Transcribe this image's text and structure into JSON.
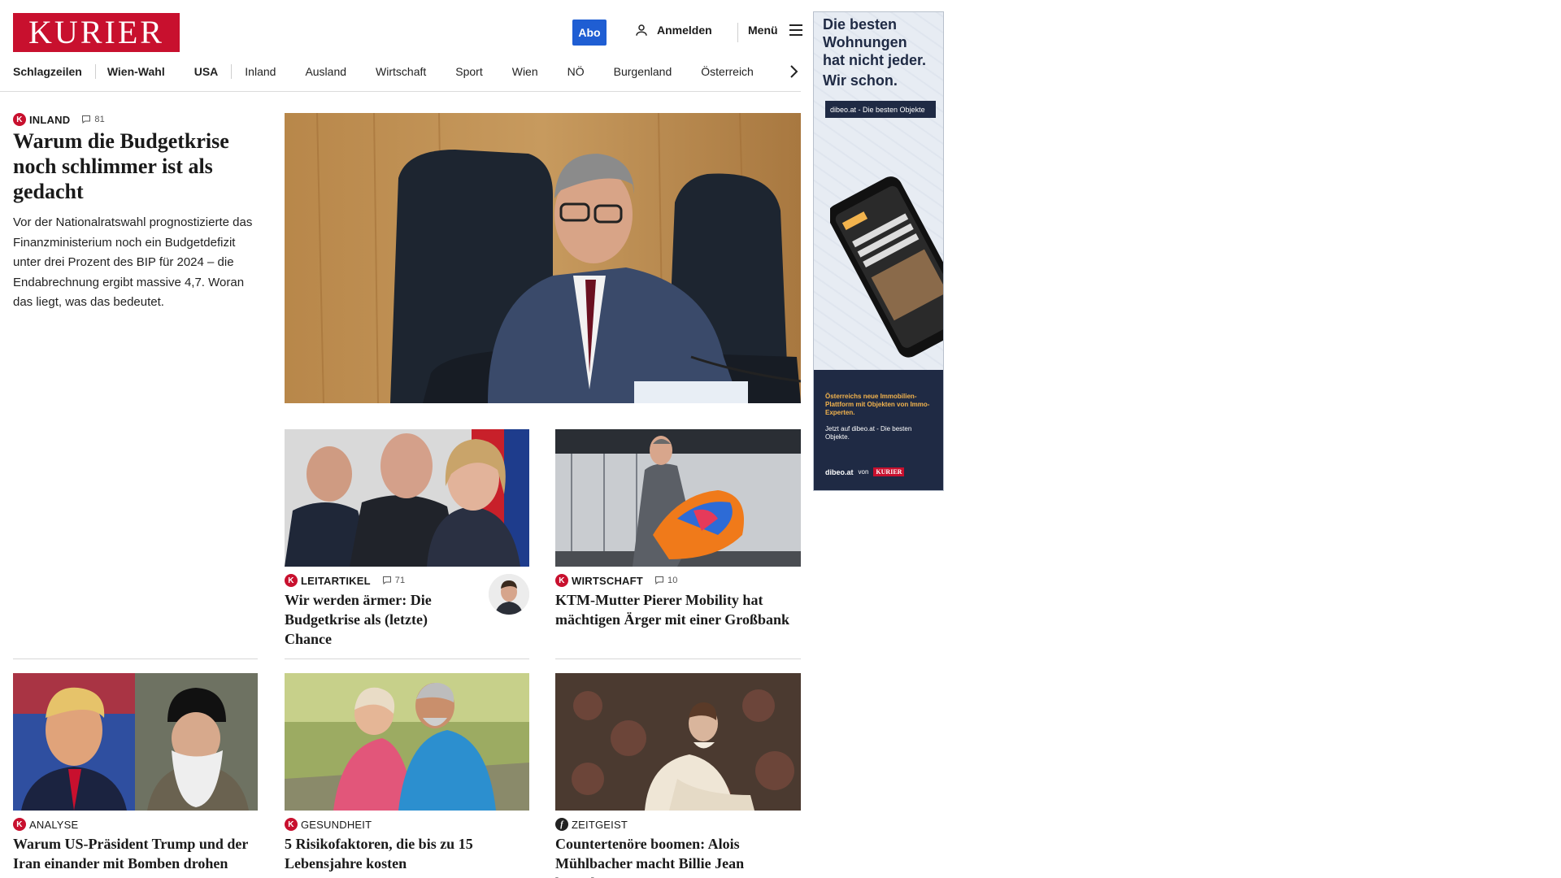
{
  "header": {
    "logo_text": "KURIER",
    "abo_label": "Abo",
    "login_label": "Anmelden",
    "menu_label": "Menü"
  },
  "nav": {
    "items": [
      "Schlagzeilen",
      "Wien-Wahl",
      "USA",
      "Inland",
      "Ausland",
      "Wirtschaft",
      "Sport",
      "Wien",
      "NÖ",
      "Burgenland",
      "Österreich"
    ]
  },
  "lead": {
    "category": "INLAND",
    "comments": "81",
    "headline": "Warum die Budgetkrise noch schlimmer ist als gedacht",
    "teaser": "Vor der Nationalratswahl prognostizierte das Finanzministerium noch ein Budgetdefizit unter drei Prozent des BIP für 2024 – die Endabrechnung ergibt massive 4,7. Woran das liegt, was das bedeutet."
  },
  "articles": [
    {
      "category": "LEITARTIKEL",
      "comments": "71",
      "headline": "Wir werden ärmer: Die Budgetkrise als (letzte) Chance"
    },
    {
      "category": "WIRTSCHAFT",
      "comments": "10",
      "headline": "KTM-Mutter Pierer Mobility hat mächtigen Ärger mit einer Großbank"
    },
    {
      "category": "ANALYSE",
      "headline": "Warum US-Präsident Trump und der Iran einander mit Bomben drohen"
    },
    {
      "category": "GESUNDHEIT",
      "headline": "5 Risikofaktoren, die bis zu 15 Lebensjahre kosten"
    },
    {
      "category": "ZEITGEIST",
      "headline": "Countertenöre boomen: Alois Mühlbacher macht Billie Jean barock"
    }
  ],
  "ad": {
    "headline": "Die besten Wohnungen hat nicht jeder.",
    "tagline": "Wir schon.",
    "badge": "dibeo.at - Die besten Objekte",
    "promo": "Österreichs neue Immobilien-Plattform mit Objekten von Immo-Experten.",
    "cta": "Jetzt auf dibeo.at - Die besten Objekte.",
    "footer_brand": "dibeo.at",
    "footer_von": "von",
    "footer_kurier": "KURIER"
  },
  "colors": {
    "brand_red": "#c8102e",
    "abo_blue": "#1f5ed3"
  }
}
